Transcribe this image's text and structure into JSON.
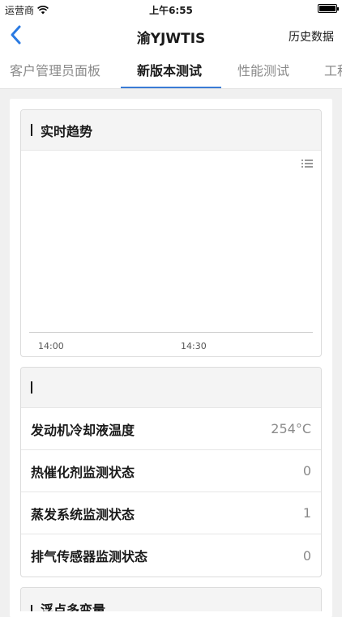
{
  "status": {
    "carrier": "运营商",
    "time": "上午6:55"
  },
  "nav": {
    "title": "渝YJWTIS",
    "history": "历史数据"
  },
  "tabs": [
    {
      "label": "客户管理员面板",
      "active": false
    },
    {
      "label": "新版本测试",
      "active": true
    },
    {
      "label": "性能测试",
      "active": false
    },
    {
      "label": "工程",
      "active": false
    }
  ],
  "trend_card": {
    "title": "实时趋势",
    "ticks": [
      "14:00",
      "14:30"
    ]
  },
  "status_card": {
    "title": "",
    "rows": [
      {
        "label": "发动机冷却液温度",
        "value": "254°C"
      },
      {
        "label": "热催化剂监测状态",
        "value": "0"
      },
      {
        "label": "蒸发系统监测状态",
        "value": "1"
      },
      {
        "label": "排气传感器监测状态",
        "value": "0"
      }
    ]
  },
  "bottom_card": {
    "title": "浮点多变量"
  },
  "icons": {
    "back": "chevron-left-icon",
    "wifi": "wifi-icon",
    "battery": "battery-icon",
    "chart_menu": "list-icon"
  },
  "colors": {
    "accent": "#3a7bd5",
    "back_arrow": "#2a7ae2"
  }
}
